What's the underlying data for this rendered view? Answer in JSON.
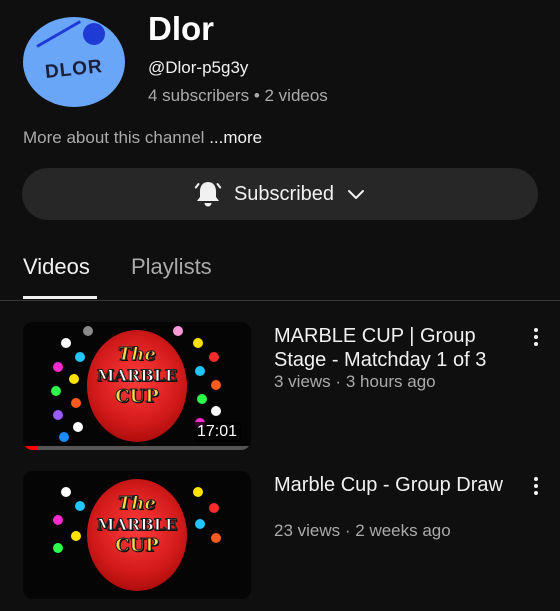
{
  "channel": {
    "name": "Dlor",
    "handle": "@Dlor-p5g3y",
    "stats": "4 subscribers • 2 videos",
    "avatar_text": "DLOR",
    "about_text": "More about this channel",
    "about_more": "...more",
    "subscribe_label": "Subscribed"
  },
  "tabs": [
    {
      "label": "Videos",
      "selected": true
    },
    {
      "label": "Playlists",
      "selected": false
    }
  ],
  "videos": [
    {
      "title": "MARBLE CUP | Group Stage - Matchday 1 of 3",
      "views": "3 views",
      "age": "3 hours ago",
      "duration": "17:01",
      "thumb_text": [
        "The",
        "MARBLE",
        "CUP"
      ],
      "progress": 0.06
    },
    {
      "title": "Marble Cup - Group Draw",
      "views": "23 views",
      "age": "2 weeks ago",
      "duration": "",
      "thumb_text": [
        "The",
        "MARBLE",
        "CUP"
      ]
    }
  ],
  "colors": {
    "background": "#0f0f0f",
    "avatar_bg": "#6aa6f8",
    "button_bg": "#272727",
    "progress": "#ff0000"
  },
  "icons": {
    "subscribe": "bell-icon",
    "dropdown": "chevron-down-icon",
    "menu": "more-vert-icon"
  }
}
